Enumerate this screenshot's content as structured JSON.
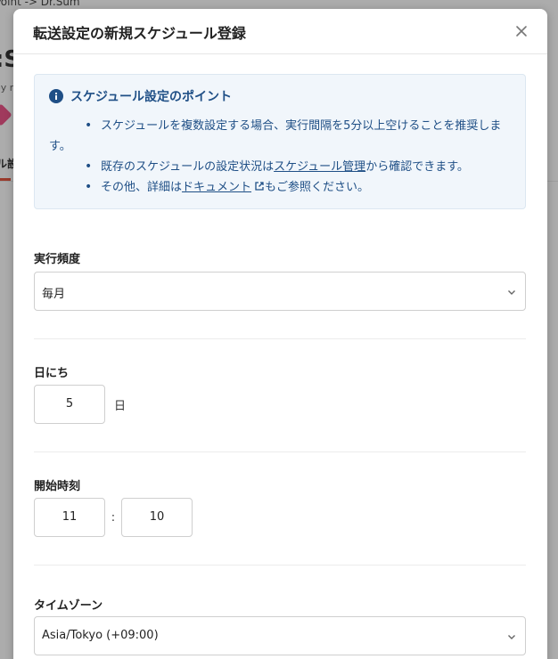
{
  "background": {
    "breadcrumb": "Point -> Dr.Sum",
    "title": ":S",
    "by_text": "oy r",
    "tab_label": "ル設"
  },
  "modal": {
    "title": "転送設定の新規スケジュール登録",
    "info": {
      "heading": "スケジュール設定のポイント",
      "item1_line1": "スケジュールを複数設定する場合、実行間隔を5分以上空けることを推奨しま",
      "item1_line2": "す。",
      "item2_prefix": "既存のスケジュールの設定状況は",
      "item2_link": "スケジュール管理",
      "item2_suffix": "から確認できます。",
      "item3_prefix": "その他、詳細は",
      "item3_link": "ドキュメント",
      "item3_suffix": "もご参照ください。",
      "bullet": "•"
    },
    "frequency": {
      "label": "実行頻度",
      "value": "毎月"
    },
    "day": {
      "label": "日にち",
      "value": "5",
      "unit": "日"
    },
    "start_time": {
      "label": "開始時刻",
      "hour": "11",
      "separator": ":",
      "minute": "10"
    },
    "timezone": {
      "label": "タイムゾーン",
      "value": "Asia/Tokyo (+09:00)"
    }
  },
  "colors": {
    "info_text": "#1f4f86",
    "info_bg": "#f1f6fb",
    "accent_red": "#d8452e"
  }
}
